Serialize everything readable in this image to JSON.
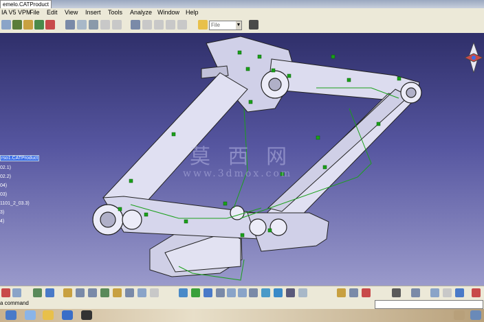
{
  "window": {
    "title": "emelo.CATProduct",
    "app_name": "IA V5 VPM"
  },
  "menu": [
    "File",
    "Edit",
    "View",
    "Insert",
    "Tools",
    "Analyze",
    "Window",
    "Help"
  ],
  "toolbar": {
    "combo_value": "File"
  },
  "tree": {
    "selected": "rso1.CATProduct",
    "items": [
      "02.1)",
      "02.2)",
      "04)",
      "03)",
      "1101_2_03.3)",
      "3)",
      "4)"
    ]
  },
  "watermark": {
    "chars": "莫 西 网",
    "url": "www.3dmox.com"
  },
  "command": {
    "label": "a command",
    "value": ""
  },
  "colors": {
    "viewport_top": "#2f2f6a",
    "viewport_bottom": "#9a9acb",
    "part_fill": "#d9d9ee",
    "constraint": "#1aa01a",
    "selection": "#3a6ee8"
  },
  "icons": [
    "select-icon",
    "sketch-icon",
    "explode-icon",
    "product-icon",
    "open-icon",
    "catalog-icon",
    "pan-icon",
    "rotate-icon",
    "zoom-in-icon",
    "zoom-out-icon",
    "normal-view-icon",
    "isometric-view-icon",
    "shading-icon",
    "hide-show-icon",
    "swap-space-icon"
  ]
}
